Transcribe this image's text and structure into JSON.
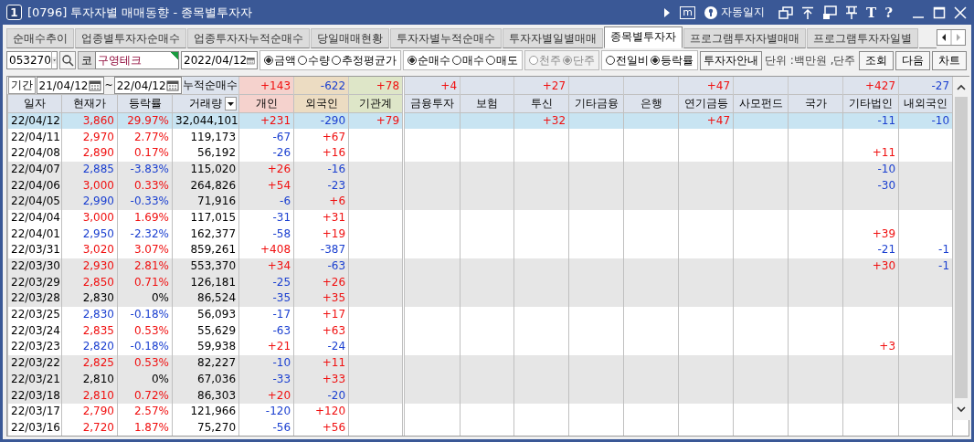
{
  "window": {
    "badge": "1",
    "title": "[0796] 투자자별 매매동향 - 종목별투자자",
    "tools": [
      {
        "kind": "play"
      },
      {
        "kind": "boxed",
        "label": "m"
      },
      {
        "kind": "journal",
        "label": "자동일지"
      },
      {
        "kind": "windows"
      },
      {
        "kind": "upload"
      },
      {
        "kind": "lock-window"
      },
      {
        "kind": "pin"
      },
      {
        "kind": "letter",
        "label": "T"
      },
      {
        "kind": "letter",
        "label": "?"
      },
      {
        "kind": "minimize"
      },
      {
        "kind": "maximize"
      },
      {
        "kind": "close"
      }
    ]
  },
  "tabs": [
    {
      "label": "순매수추이",
      "selected": false
    },
    {
      "label": "업종별투자자순매수",
      "selected": false
    },
    {
      "label": "업종투자자누적순매수",
      "selected": false
    },
    {
      "label": "당일매매현황",
      "selected": false
    },
    {
      "label": "투자자별누적순매수",
      "selected": false
    },
    {
      "label": "투자자별일별매매",
      "selected": false
    },
    {
      "label": "종목별투자자",
      "selected": true
    },
    {
      "label": "프로그램투자자별매매",
      "selected": false
    },
    {
      "label": "프로그램투자자일별",
      "selected": false
    }
  ],
  "toolbar": {
    "code": "053270",
    "market": "코",
    "stock_name": "구영테크",
    "date": "2022/04/12",
    "radio_groups": [
      {
        "disabled": false,
        "options": [
          {
            "label": "금액",
            "selected": true
          },
          {
            "label": "수량",
            "selected": false
          },
          {
            "label": "추정평균가",
            "selected": false
          }
        ]
      },
      {
        "disabled": false,
        "options": [
          {
            "label": "순매수",
            "selected": true
          },
          {
            "label": "매수",
            "selected": false
          },
          {
            "label": "매도",
            "selected": false
          }
        ]
      },
      {
        "disabled": true,
        "options": [
          {
            "label": "천주",
            "selected": false
          },
          {
            "label": "단주",
            "selected": true
          }
        ]
      },
      {
        "disabled": false,
        "options": [
          {
            "label": "전일비",
            "selected": false
          },
          {
            "label": "등락률",
            "selected": true
          }
        ]
      }
    ],
    "guide_button": "투자자안내",
    "unit": "단위 :백만원 ,단주",
    "actions": [
      "조회",
      "다음",
      "차트"
    ]
  },
  "period": {
    "label": "기간",
    "from": "21/04/12",
    "separator": "~",
    "to": "22/04/12",
    "cumulative_label": "누적순매수"
  },
  "table": {
    "columns": [
      {
        "label": "일자"
      },
      {
        "label": "현재가"
      },
      {
        "label": "등락률"
      },
      {
        "label": "거래량",
        "sortable": true
      }
    ],
    "investors": [
      {
        "label": "개인",
        "color": "#f5d2cd",
        "total": {
          "value": "+143",
          "color": "#f01010"
        }
      },
      {
        "label": "외국인",
        "color": "#ecdcc2",
        "total": {
          "value": "-622",
          "color": "#1a3fd0"
        }
      },
      {
        "label": "기관계",
        "color": "#dee6c8",
        "total": {
          "value": "+78",
          "color": "#f01010"
        }
      },
      {
        "label": "금융투자",
        "color": "#dde3ed",
        "total": {
          "value": "+4",
          "color": "#f01010"
        }
      },
      {
        "label": "보험",
        "color": "#dde3ed"
      },
      {
        "label": "투신",
        "color": "#dde3ed",
        "total": {
          "value": "+27",
          "color": "#f01010"
        }
      },
      {
        "label": "기타금융",
        "color": "#dde3ed"
      },
      {
        "label": "은행",
        "color": "#dde3ed"
      },
      {
        "label": "연기금등",
        "color": "#dde3ed",
        "total": {
          "value": "+47",
          "color": "#f01010"
        }
      },
      {
        "label": "사모펀드",
        "color": "#dde3ed"
      },
      {
        "label": "국가",
        "color": "#dde3ed"
      },
      {
        "label": "기타법인",
        "color": "#dde3ed",
        "total": {
          "value": "+427",
          "color": "#f01010"
        }
      },
      {
        "label": "내외국인",
        "color": "#dde3ed",
        "total": {
          "value": "-27",
          "color": "#1a3fd0"
        }
      }
    ],
    "rows": [
      {
        "date": "22/04/12",
        "price": "3,860",
        "rate": "29.97%",
        "volume": "32,044,101",
        "color": "#f01010",
        "selected": true,
        "flows": {
          "individual": {
            "value": "+231",
            "color": "#f01010"
          },
          "foreigner": {
            "value": "-290",
            "color": "#1a3fd0"
          },
          "institutions": {
            "value": "+79",
            "color": "#f01010"
          },
          "investment_trust": {
            "value": "+32",
            "color": "#f01010"
          },
          "pension": {
            "value": "+47",
            "color": "#f01010"
          },
          "other_corporation": {
            "value": "-11",
            "color": "#1a3fd0"
          },
          "domestic_foreigner": {
            "value": "-10",
            "color": "#1a3fd0"
          }
        }
      },
      {
        "date": "22/04/11",
        "price": "2,970",
        "rate": "2.77%",
        "volume": "119,173",
        "color": "#f01010",
        "selected": false,
        "flows": {
          "individual": {
            "value": "-67",
            "color": "#1a3fd0"
          },
          "foreigner": {
            "value": "+67",
            "color": "#f01010"
          }
        }
      },
      {
        "date": "22/04/08",
        "price": "2,890",
        "rate": "0.17%",
        "volume": "56,192",
        "color": "#f01010",
        "selected": false,
        "flows": {
          "individual": {
            "value": "-26",
            "color": "#1a3fd0"
          },
          "foreigner": {
            "value": "+16",
            "color": "#f01010"
          },
          "other_corporation": {
            "value": "+11",
            "color": "#f01010"
          }
        }
      },
      {
        "date": "22/04/07",
        "price": "2,885",
        "rate": "-3.83%",
        "volume": "115,020",
        "color": "#1a3fd0",
        "selected": false,
        "flows": {
          "individual": {
            "value": "+26",
            "color": "#f01010"
          },
          "foreigner": {
            "value": "-16",
            "color": "#1a3fd0"
          },
          "other_corporation": {
            "value": "-10",
            "color": "#1a3fd0"
          }
        }
      },
      {
        "date": "22/04/06",
        "price": "3,000",
        "rate": "0.33%",
        "volume": "264,826",
        "color": "#f01010",
        "selected": false,
        "flows": {
          "individual": {
            "value": "+54",
            "color": "#f01010"
          },
          "foreigner": {
            "value": "-23",
            "color": "#1a3fd0"
          },
          "other_corporation": {
            "value": "-30",
            "color": "#1a3fd0"
          }
        }
      },
      {
        "date": "22/04/05",
        "price": "2,990",
        "rate": "-0.33%",
        "volume": "71,916",
        "color": "#1a3fd0",
        "selected": false,
        "flows": {
          "individual": {
            "value": "-6",
            "color": "#1a3fd0"
          },
          "foreigner": {
            "value": "+6",
            "color": "#f01010"
          }
        }
      },
      {
        "date": "22/04/04",
        "price": "3,000",
        "rate": "1.69%",
        "volume": "117,015",
        "color": "#f01010",
        "selected": false,
        "flows": {
          "individual": {
            "value": "-31",
            "color": "#1a3fd0"
          },
          "foreigner": {
            "value": "+31",
            "color": "#f01010"
          }
        }
      },
      {
        "date": "22/04/01",
        "price": "2,950",
        "rate": "-2.32%",
        "volume": "162,377",
        "color": "#1a3fd0",
        "selected": false,
        "flows": {
          "individual": {
            "value": "-58",
            "color": "#1a3fd0"
          },
          "foreigner": {
            "value": "+19",
            "color": "#f01010"
          },
          "other_corporation": {
            "value": "+39",
            "color": "#f01010"
          }
        }
      },
      {
        "date": "22/03/31",
        "price": "3,020",
        "rate": "3.07%",
        "volume": "859,261",
        "color": "#f01010",
        "selected": false,
        "flows": {
          "individual": {
            "value": "+408",
            "color": "#f01010"
          },
          "foreigner": {
            "value": "-387",
            "color": "#1a3fd0"
          },
          "other_corporation": {
            "value": "-21",
            "color": "#1a3fd0"
          },
          "domestic_foreigner": {
            "value": "-1",
            "color": "#1a3fd0"
          }
        }
      },
      {
        "date": "22/03/30",
        "price": "2,930",
        "rate": "2.81%",
        "volume": "553,370",
        "color": "#f01010",
        "selected": false,
        "flows": {
          "individual": {
            "value": "+34",
            "color": "#f01010"
          },
          "foreigner": {
            "value": "-63",
            "color": "#1a3fd0"
          },
          "other_corporation": {
            "value": "+30",
            "color": "#f01010"
          },
          "domestic_foreigner": {
            "value": "-1",
            "color": "#1a3fd0"
          }
        }
      },
      {
        "date": "22/03/29",
        "price": "2,850",
        "rate": "0.71%",
        "volume": "126,181",
        "color": "#f01010",
        "selected": false,
        "flows": {
          "individual": {
            "value": "-25",
            "color": "#1a3fd0"
          },
          "foreigner": {
            "value": "+26",
            "color": "#f01010"
          }
        }
      },
      {
        "date": "22/03/28",
        "price": "2,830",
        "rate": "0%",
        "volume": "86,524",
        "color": "#000000",
        "selected": false,
        "flows": {
          "individual": {
            "value": "-35",
            "color": "#1a3fd0"
          },
          "foreigner": {
            "value": "+35",
            "color": "#f01010"
          }
        }
      },
      {
        "date": "22/03/25",
        "price": "2,830",
        "rate": "-0.18%",
        "volume": "56,093",
        "color": "#1a3fd0",
        "selected": false,
        "flows": {
          "individual": {
            "value": "-17",
            "color": "#1a3fd0"
          },
          "foreigner": {
            "value": "+17",
            "color": "#f01010"
          }
        }
      },
      {
        "date": "22/03/24",
        "price": "2,835",
        "rate": "0.53%",
        "volume": "55,629",
        "color": "#f01010",
        "selected": false,
        "flows": {
          "individual": {
            "value": "-63",
            "color": "#1a3fd0"
          },
          "foreigner": {
            "value": "+63",
            "color": "#f01010"
          }
        }
      },
      {
        "date": "22/03/23",
        "price": "2,820",
        "rate": "-0.18%",
        "volume": "59,938",
        "color": "#1a3fd0",
        "selected": false,
        "flows": {
          "individual": {
            "value": "+21",
            "color": "#f01010"
          },
          "foreigner": {
            "value": "-24",
            "color": "#1a3fd0"
          },
          "other_corporation": {
            "value": "+3",
            "color": "#f01010"
          }
        }
      },
      {
        "date": "22/03/22",
        "price": "2,825",
        "rate": "0.53%",
        "volume": "82,227",
        "color": "#f01010",
        "selected": false,
        "flows": {
          "individual": {
            "value": "-10",
            "color": "#1a3fd0"
          },
          "foreigner": {
            "value": "+11",
            "color": "#f01010"
          }
        }
      },
      {
        "date": "22/03/21",
        "price": "2,810",
        "rate": "0%",
        "volume": "67,036",
        "color": "#000000",
        "selected": false,
        "flows": {
          "individual": {
            "value": "-33",
            "color": "#1a3fd0"
          },
          "foreigner": {
            "value": "+33",
            "color": "#f01010"
          }
        }
      },
      {
        "date": "22/03/18",
        "price": "2,810",
        "rate": "0.72%",
        "volume": "86,303",
        "color": "#f01010",
        "selected": false,
        "flows": {
          "individual": {
            "value": "+20",
            "color": "#f01010"
          },
          "foreigner": {
            "value": "-20",
            "color": "#1a3fd0"
          }
        }
      },
      {
        "date": "22/03/17",
        "price": "2,790",
        "rate": "2.57%",
        "volume": "121,966",
        "color": "#f01010",
        "selected": false,
        "flows": {
          "individual": {
            "value": "-120",
            "color": "#1a3fd0"
          },
          "foreigner": {
            "value": "+120",
            "color": "#f01010"
          }
        }
      },
      {
        "date": "22/03/16",
        "price": "2,720",
        "rate": "1.87%",
        "volume": "75,270",
        "color": "#f01010",
        "selected": false,
        "flows": {
          "individual": {
            "value": "-56",
            "color": "#1a3fd0"
          },
          "foreigner": {
            "value": "+56",
            "color": "#f01010"
          }
        }
      }
    ]
  }
}
